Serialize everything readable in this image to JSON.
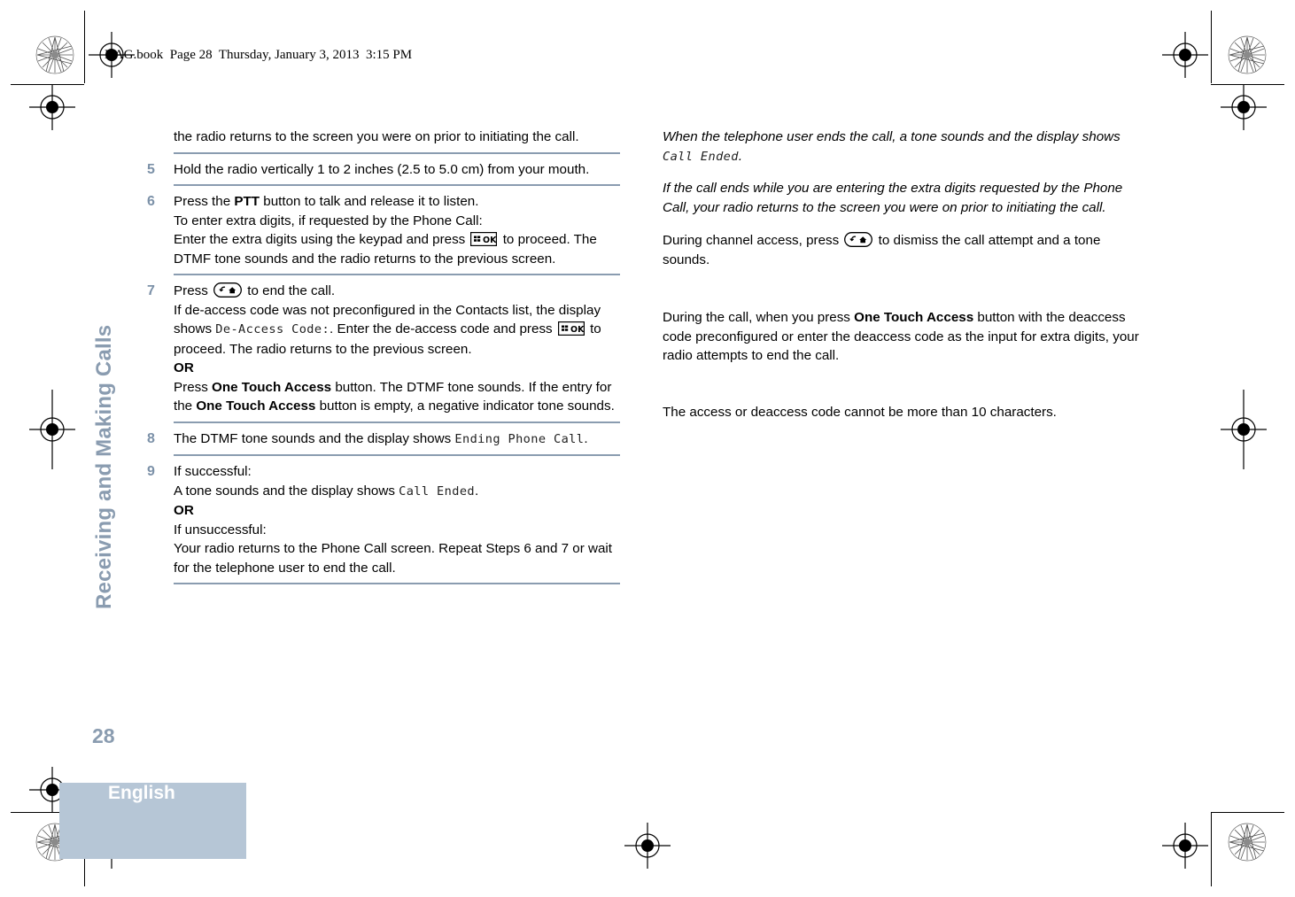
{
  "header": {
    "slug": "NAG.book  Page 28  Thursday, January 3, 2013  3:15 PM"
  },
  "sidebar": {
    "chapter_title": "Receiving and Making Calls",
    "page_number": "28"
  },
  "footer": {
    "language": "English",
    "bar_color": "#b6c6d6"
  },
  "colors": {
    "accent": "#8a9cb0",
    "step_number": "#7c91a8",
    "rule": "#8a9cb0",
    "text": "#000000"
  },
  "icons": {
    "ok_key": "ok-key-icon",
    "end_call_key": "end-call-key-icon"
  },
  "left_column": {
    "continuation": {
      "text": "the radio returns to the screen you were on prior to initiating the call."
    },
    "steps": [
      {
        "number": "5",
        "lines": [
          {
            "type": "text",
            "text": "Hold the radio vertically 1 to 2 inches (2.5 to 5.0 cm) from your mouth."
          }
        ]
      },
      {
        "number": "6",
        "lines": [
          {
            "type": "rich",
            "segments": [
              {
                "t": "Press the ",
                "s": "normal"
              },
              {
                "t": "PTT",
                "s": "bold"
              },
              {
                "t": " button to talk and release it to listen.",
                "s": "normal"
              }
            ]
          },
          {
            "type": "text",
            "text": "To enter extra digits, if requested by the Phone Call:"
          },
          {
            "type": "rich",
            "segments": [
              {
                "t": "Enter the extra digits using the keypad and press ",
                "s": "normal"
              },
              {
                "t": "",
                "s": "icon-ok"
              },
              {
                "t": " to proceed. The DTMF tone sounds and the radio returns to the previous screen.",
                "s": "normal"
              }
            ]
          }
        ]
      },
      {
        "number": "7",
        "lines": [
          {
            "type": "rich",
            "segments": [
              {
                "t": "Press ",
                "s": "normal"
              },
              {
                "t": "",
                "s": "icon-end"
              },
              {
                "t": " to end the call.",
                "s": "normal"
              }
            ]
          },
          {
            "type": "rich",
            "segments": [
              {
                "t": "If de-access code was not preconfigured in the Contacts list, the display shows ",
                "s": "normal"
              },
              {
                "t": "De-Access Code:",
                "s": "lcd"
              },
              {
                "t": ". Enter the de-access code and press ",
                "s": "normal"
              },
              {
                "t": "",
                "s": "icon-ok"
              },
              {
                "t": " to proceed. The radio returns to the previous screen.",
                "s": "normal"
              }
            ]
          },
          {
            "type": "text",
            "text": "OR",
            "style": "bold"
          },
          {
            "type": "rich",
            "segments": [
              {
                "t": "Press ",
                "s": "normal"
              },
              {
                "t": "One Touch Access",
                "s": "bold"
              },
              {
                "t": " button. The DTMF tone sounds. If the entry for the ",
                "s": "normal"
              },
              {
                "t": "One Touch Access",
                "s": "bold"
              },
              {
                "t": " button is empty, a negative indicator tone sounds.",
                "s": "normal"
              }
            ]
          }
        ]
      },
      {
        "number": "8",
        "lines": [
          {
            "type": "rich",
            "segments": [
              {
                "t": "The DTMF tone sounds and the display shows ",
                "s": "normal"
              },
              {
                "t": "Ending Phone Call",
                "s": "lcd"
              },
              {
                "t": ".",
                "s": "normal"
              }
            ]
          }
        ]
      },
      {
        "number": "9",
        "lines": [
          {
            "type": "text",
            "text": "If successful:"
          },
          {
            "type": "rich",
            "segments": [
              {
                "t": "A tone sounds and the display shows ",
                "s": "normal"
              },
              {
                "t": "Call Ended",
                "s": "lcd"
              },
              {
                "t": ".",
                "s": "normal"
              }
            ]
          },
          {
            "type": "text",
            "text": "OR",
            "style": "bold"
          },
          {
            "type": "text",
            "text": "If unsuccessful:"
          },
          {
            "type": "text",
            "text": "Your radio returns to the Phone Call screen. Repeat Steps 6 and 7 or wait for the telephone user to end the call."
          }
        ]
      }
    ]
  },
  "right_column": {
    "paragraphs": [
      {
        "id": "p1",
        "style": "italic",
        "segments": [
          {
            "t": "When the telephone user ends the call, a tone sounds and the display shows ",
            "s": "italic"
          },
          {
            "t": "Call Ended",
            "s": "lcd"
          },
          {
            "t": ".",
            "s": "italic"
          }
        ]
      },
      {
        "id": "p2",
        "style": "italic",
        "segments": [
          {
            "t": "If the call ends while you are entering the extra digits requested by the Phone Call, your radio returns to the screen you were on prior to initiating the call.",
            "s": "italic"
          }
        ]
      },
      {
        "id": "p3",
        "style": "normal",
        "segments": [
          {
            "t": "During channel access, press ",
            "s": "normal"
          },
          {
            "t": "",
            "s": "icon-end"
          },
          {
            "t": " to dismiss the call attempt and a tone sounds.",
            "s": "normal"
          }
        ]
      },
      {
        "id": "p4",
        "style": "normal",
        "segments": [
          {
            "t": "During the call, when you press ",
            "s": "normal"
          },
          {
            "t": "One Touch Access",
            "s": "bold"
          },
          {
            "t": " button with the deaccess code preconfigured or enter the deaccess code as the input for extra digits, your radio attempts to end the call.",
            "s": "normal"
          }
        ]
      },
      {
        "id": "p5",
        "style": "normal",
        "segments": [
          {
            "t": "The access or deaccess code cannot be more than 10 characters.",
            "s": "normal"
          }
        ]
      }
    ]
  }
}
